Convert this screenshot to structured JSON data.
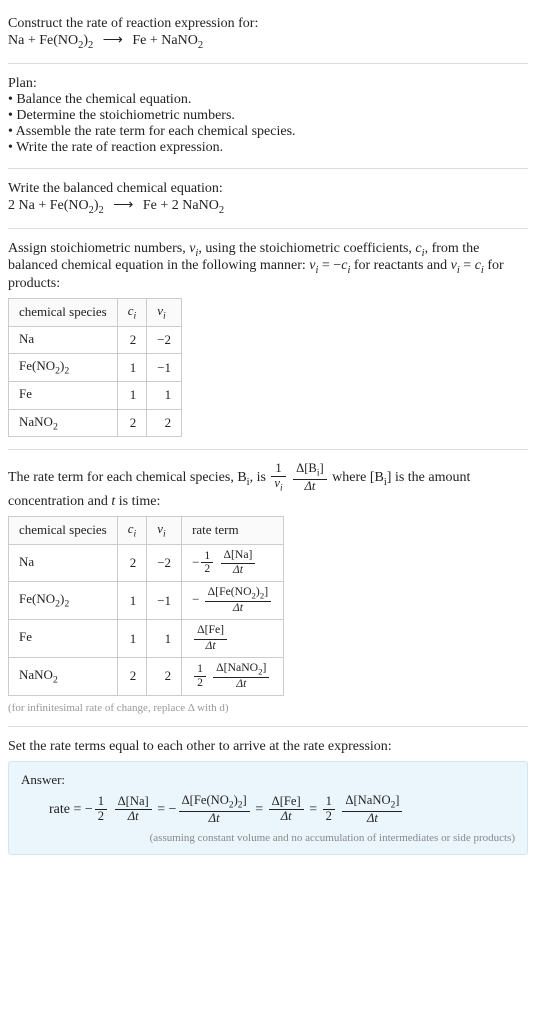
{
  "header": {
    "prompt": "Construct the rate of reaction expression for:",
    "equation_lhs_1": "Na",
    "equation_plus": " + ",
    "equation_lhs_2": "Fe(NO",
    "equation_lhs_2_sub1": "2",
    "equation_lhs_2_mid": ")",
    "equation_lhs_2_sub2": "2",
    "arrow": "⟶",
    "equation_rhs_1": "Fe",
    "equation_rhs_2a": "NaNO",
    "equation_rhs_2a_sub": "2"
  },
  "plan": {
    "title": "Plan:",
    "items": [
      "Balance the chemical equation.",
      "Determine the stoichiometric numbers.",
      "Assemble the rate term for each chemical species.",
      "Write the rate of reaction expression."
    ]
  },
  "balanced": {
    "title": "Write the balanced chemical equation:",
    "c1": "2 Na",
    "plus": " + ",
    "c2a": "Fe(NO",
    "c2_sub1": "2",
    "c2_mid": ")",
    "c2_sub2": "2",
    "arrow": "⟶",
    "c3": "Fe",
    "c4a": "2 NaNO",
    "c4_sub": "2"
  },
  "assign": {
    "text_a": "Assign stoichiometric numbers, ",
    "nu_i": "ν",
    "sub_i": "i",
    "text_b": ", using the stoichiometric coefficients, ",
    "c_i": "c",
    "text_c": ", from the balanced chemical equation in the following manner: ",
    "rel1a": "ν",
    "rel1b": " = −",
    "rel1c": "c",
    "text_d": " for reactants and ",
    "rel2a": "ν",
    "rel2b": " = ",
    "rel2c": "c",
    "text_e": " for products:"
  },
  "table1": {
    "headers": {
      "h1": "chemical species",
      "h2": "c",
      "h2sub": "i",
      "h3": "ν",
      "h3sub": "i"
    },
    "rows": [
      {
        "name_a": "Na",
        "name_sub1": "",
        "name_mid": "",
        "name_sub2": "",
        "ci": "2",
        "nui": "−2"
      },
      {
        "name_a": "Fe(NO",
        "name_sub1": "2",
        "name_mid": ")",
        "name_sub2": "2",
        "ci": "1",
        "nui": "−1"
      },
      {
        "name_a": "Fe",
        "name_sub1": "",
        "name_mid": "",
        "name_sub2": "",
        "ci": "1",
        "nui": "1"
      },
      {
        "name_a": "NaNO",
        "name_sub1": "2",
        "name_mid": "",
        "name_sub2": "",
        "ci": "2",
        "nui": "2"
      }
    ]
  },
  "rateterm": {
    "text_a": "The rate term for each chemical species, B",
    "sub_i": "i",
    "text_b": ", is ",
    "frac1_top": "1",
    "frac1_bot_a": "ν",
    "frac1_bot_sub": "i",
    "frac2_top_a": "Δ[B",
    "frac2_top_sub": "i",
    "frac2_top_b": "]",
    "frac2_bot": "Δt",
    "text_c": " where [B",
    "text_d": "] is the amount concentration and ",
    "t": "t",
    "text_e": " is time:"
  },
  "table2": {
    "headers": {
      "h1": "chemical species",
      "h2": "c",
      "h2sub": "i",
      "h3": "ν",
      "h3sub": "i",
      "h4": "rate term"
    },
    "rows": [
      {
        "name_a": "Na",
        "name_sub1": "",
        "name_mid": "",
        "name_sub2": "",
        "ci": "2",
        "nui": "−2",
        "neg": "−",
        "coef_top": "1",
        "coef_bot": "2",
        "d_top_a": "Δ[Na",
        "d_top_sub1": "",
        "d_top_mid": "",
        "d_top_sub2": "",
        "d_top_b": "]",
        "d_bot": "Δt"
      },
      {
        "name_a": "Fe(NO",
        "name_sub1": "2",
        "name_mid": ")",
        "name_sub2": "2",
        "ci": "1",
        "nui": "−1",
        "neg": "−",
        "coef_top": "",
        "coef_bot": "",
        "d_top_a": "Δ[Fe(NO",
        "d_top_sub1": "2",
        "d_top_mid": ")",
        "d_top_sub2": "2",
        "d_top_b": "]",
        "d_bot": "Δt"
      },
      {
        "name_a": "Fe",
        "name_sub1": "",
        "name_mid": "",
        "name_sub2": "",
        "ci": "1",
        "nui": "1",
        "neg": "",
        "coef_top": "",
        "coef_bot": "",
        "d_top_a": "Δ[Fe",
        "d_top_sub1": "",
        "d_top_mid": "",
        "d_top_sub2": "",
        "d_top_b": "]",
        "d_bot": "Δt"
      },
      {
        "name_a": "NaNO",
        "name_sub1": "2",
        "name_mid": "",
        "name_sub2": "",
        "ci": "2",
        "nui": "2",
        "neg": "",
        "coef_top": "1",
        "coef_bot": "2",
        "d_top_a": "Δ[NaNO",
        "d_top_sub1": "2",
        "d_top_mid": "",
        "d_top_sub2": "",
        "d_top_b": "]",
        "d_bot": "Δt"
      }
    ],
    "note": "(for infinitesimal rate of change, replace Δ with d)"
  },
  "final": {
    "title": "Set the rate terms equal to each other to arrive at the rate expression:"
  },
  "answer": {
    "label": "Answer:",
    "rate": "rate = ",
    "t1_neg": "−",
    "t1_top": "1",
    "t1_bot": "2",
    "t1d_top": "Δ[Na]",
    "t1d_bot": "Δt",
    "eq1": " = ",
    "t2_neg": "−",
    "t2d_top_a": "Δ[Fe(NO",
    "t2d_top_sub1": "2",
    "t2d_top_mid": ")",
    "t2d_top_sub2": "2",
    "t2d_top_b": "]",
    "t2d_bot": "Δt",
    "eq2": " = ",
    "t3d_top": "Δ[Fe]",
    "t3d_bot": "Δt",
    "eq3": " = ",
    "t4_top": "1",
    "t4_bot": "2",
    "t4d_top_a": "Δ[NaNO",
    "t4d_top_sub": "2",
    "t4d_top_b": "]",
    "t4d_bot": "Δt",
    "footnote": "(assuming constant volume and no accumulation of intermediates or side products)"
  }
}
